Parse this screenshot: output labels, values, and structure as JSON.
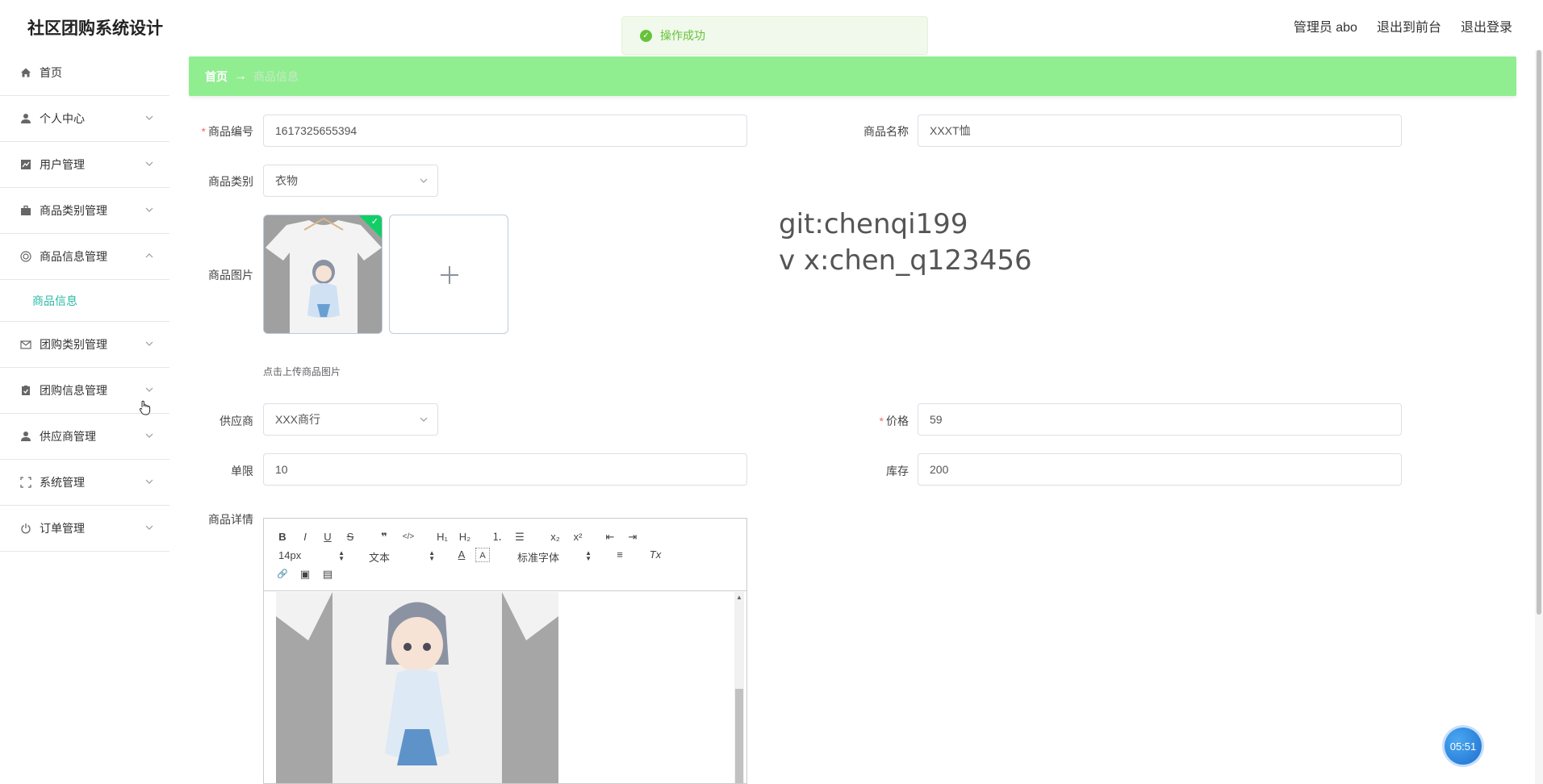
{
  "app_title": "社区团购系统设计",
  "header": {
    "user_label": "管理员 abo",
    "to_frontend": "退出到前台",
    "logout": "退出登录"
  },
  "toast": {
    "message": "操作成功"
  },
  "sidebar": {
    "items": [
      {
        "label": "首页",
        "icon": "home-icon"
      },
      {
        "label": "个人中心",
        "icon": "user-icon"
      },
      {
        "label": "用户管理",
        "icon": "chart-icon"
      },
      {
        "label": "商品类别管理",
        "icon": "briefcase-icon"
      },
      {
        "label": "商品信息管理",
        "icon": "target-icon",
        "expanded": true,
        "children": [
          {
            "label": "商品信息"
          }
        ]
      },
      {
        "label": "团购类别管理",
        "icon": "mail-icon"
      },
      {
        "label": "团购信息管理",
        "icon": "clipboard-icon"
      },
      {
        "label": "供应商管理",
        "icon": "user-icon"
      },
      {
        "label": "系统管理",
        "icon": "fullscreen-icon"
      },
      {
        "label": "订单管理",
        "icon": "power-icon"
      }
    ]
  },
  "breadcrumb": {
    "home": "首页",
    "arrow": "→",
    "current": "商品信息"
  },
  "form": {
    "product_no": {
      "label": "商品编号",
      "value": "1617325655394",
      "required": true
    },
    "product_name": {
      "label": "商品名称",
      "value": "XXXT恤"
    },
    "category": {
      "label": "商品类别",
      "value": "衣物"
    },
    "image": {
      "label": "商品图片",
      "tip": "点击上传商品图片"
    },
    "supplier": {
      "label": "供应商",
      "value": "XXX商行"
    },
    "price": {
      "label": "价格",
      "value": "59",
      "required": true
    },
    "limit": {
      "label": "单限",
      "value": "10"
    },
    "stock": {
      "label": "库存",
      "value": "200"
    },
    "detail": {
      "label": "商品详情"
    }
  },
  "watermark": {
    "line1": "git:chenqi199",
    "line2": "v x:chen_q123456"
  },
  "editor": {
    "toolbar": {
      "bold": "B",
      "italic": "I",
      "underline": "U",
      "strike": "S",
      "quote": "❞",
      "code": "</>",
      "h1": "H₁",
      "h2": "H₂",
      "ol": "⒈",
      "ul": "☰",
      "sub": "x₂",
      "sup": "x²",
      "outdent": "⇤",
      "indent": "⇥",
      "size": "14px",
      "header": "文本",
      "font": "标准字体",
      "color": "A",
      "bg": "A",
      "align": "≡",
      "clean": "Tx",
      "link": "🔗",
      "image": "▣",
      "video": "▤"
    }
  },
  "timer": "05:51",
  "colors": {
    "breadcrumb_bg": "#90ee90",
    "active": "#2bb8a8",
    "success": "#67c23a"
  }
}
